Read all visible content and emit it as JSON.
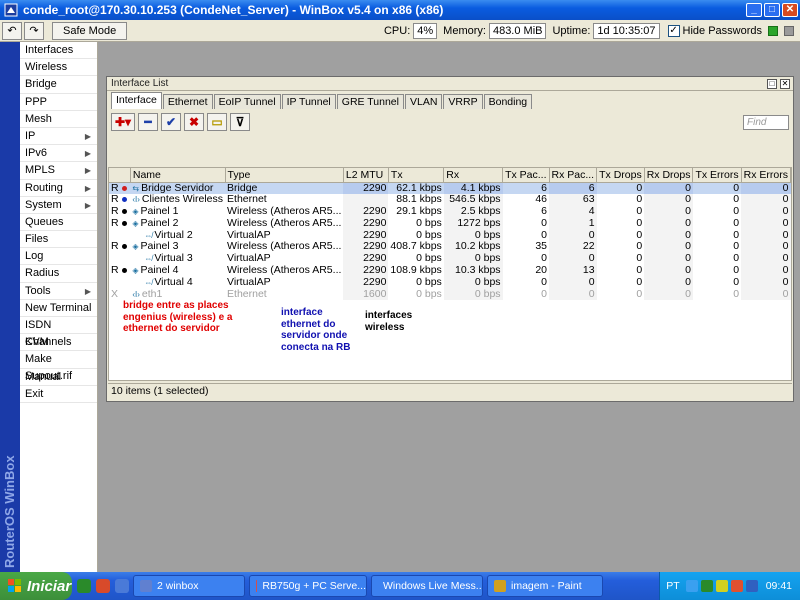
{
  "window": {
    "title": "conde_root@170.30.10.253 (CondeNet_Server) - WinBox v5.4 on x86 (x86)",
    "minimize": "_",
    "maximize": "□",
    "close": "✕"
  },
  "toolbar": {
    "undo": "↶",
    "redo": "↷",
    "safe_mode": "Safe Mode",
    "cpu_label": "CPU:",
    "cpu_value": "4%",
    "memory_label": "Memory:",
    "memory_value": "483.0 MiB",
    "uptime_label": "Uptime:",
    "uptime_value": "1d 10:35:07",
    "hide_passwords_label": "Hide Passwords",
    "hide_passwords_check": "✓"
  },
  "brand": "RouterOS WinBox",
  "sidebar": {
    "items": [
      {
        "label": "Interfaces",
        "arrow": ""
      },
      {
        "label": "Wireless",
        "arrow": ""
      },
      {
        "label": "Bridge",
        "arrow": ""
      },
      {
        "label": "PPP",
        "arrow": ""
      },
      {
        "label": "Mesh",
        "arrow": ""
      },
      {
        "label": "IP",
        "arrow": "▶"
      },
      {
        "label": "IPv6",
        "arrow": "▶"
      },
      {
        "label": "MPLS",
        "arrow": "▶"
      },
      {
        "label": "Routing",
        "arrow": "▶"
      },
      {
        "label": "System",
        "arrow": "▶"
      },
      {
        "label": "Queues",
        "arrow": ""
      },
      {
        "label": "Files",
        "arrow": ""
      },
      {
        "label": "Log",
        "arrow": ""
      },
      {
        "label": "Radius",
        "arrow": ""
      },
      {
        "label": "Tools",
        "arrow": "▶"
      },
      {
        "label": "New Terminal",
        "arrow": ""
      },
      {
        "label": "ISDN Channels",
        "arrow": ""
      },
      {
        "label": "KVM",
        "arrow": ""
      },
      {
        "label": "Make Supout.rif",
        "arrow": ""
      },
      {
        "label": "Manual",
        "arrow": ""
      },
      {
        "label": "Exit",
        "arrow": ""
      }
    ]
  },
  "iface_window": {
    "title": "Interface List",
    "restore": "□",
    "close": "✕",
    "tabs": [
      "Interface",
      "Ethernet",
      "EoIP Tunnel",
      "IP Tunnel",
      "GRE Tunnel",
      "VLAN",
      "VRRP",
      "Bonding"
    ],
    "actions": {
      "add": "✚▾",
      "remove": "━",
      "enable": "✔",
      "disable": "✖",
      "comment": "▭",
      "filter": "⊽"
    },
    "find_placeholder": "Find",
    "columns": [
      "",
      "Name",
      "Type",
      "L2 MTU",
      "Tx",
      "Rx",
      "Tx Pac...",
      "Rx Pac...",
      "Tx Drops",
      "Rx Drops",
      "Tx Errors",
      "Rx Errors"
    ],
    "rows": [
      {
        "flag": "R",
        "dot": "#d02020",
        "icon": "⇆",
        "name": "Bridge Servidor",
        "indent": false,
        "type": "Bridge",
        "l2mtu": "2290",
        "tx": "62.1 kbps",
        "rx": "4.1 kbps",
        "txp": "6",
        "rxp": "6",
        "txd": "0",
        "rxd": "0",
        "txe": "0",
        "rxe": "0",
        "selected": true,
        "disabled": false
      },
      {
        "flag": "R",
        "dot": "#1030c0",
        "icon": "‹I›",
        "name": "Clientes Wireless",
        "indent": false,
        "type": "Ethernet",
        "l2mtu": "",
        "tx": "88.1 kbps",
        "rx": "546.5 kbps",
        "txp": "46",
        "rxp": "63",
        "txd": "0",
        "rxd": "0",
        "txe": "0",
        "rxe": "0",
        "selected": false,
        "disabled": false
      },
      {
        "flag": "R",
        "dot": "#000000",
        "icon": "◈",
        "name": "Painel 1",
        "indent": false,
        "type": "Wireless (Atheros AR5...",
        "l2mtu": "2290",
        "tx": "29.1 kbps",
        "rx": "2.5 kbps",
        "txp": "6",
        "rxp": "4",
        "txd": "0",
        "rxd": "0",
        "txe": "0",
        "rxe": "0",
        "selected": false,
        "disabled": false
      },
      {
        "flag": "R",
        "dot": "#000000",
        "icon": "◈",
        "name": "Painel 2",
        "indent": false,
        "type": "Wireless (Atheros AR5...",
        "l2mtu": "2290",
        "tx": "0 bps",
        "rx": "1272 bps",
        "txp": "0",
        "rxp": "1",
        "txd": "0",
        "rxd": "0",
        "txe": "0",
        "rxe": "0",
        "selected": false,
        "disabled": false
      },
      {
        "flag": "",
        "dot": "",
        "icon": "⇎",
        "name": "Virtual 2",
        "indent": true,
        "type": "VirtualAP",
        "l2mtu": "2290",
        "tx": "0 bps",
        "rx": "0 bps",
        "txp": "0",
        "rxp": "0",
        "txd": "0",
        "rxd": "0",
        "txe": "0",
        "rxe": "0",
        "selected": false,
        "disabled": false
      },
      {
        "flag": "R",
        "dot": "#000000",
        "icon": "◈",
        "name": "Painel 3",
        "indent": false,
        "type": "Wireless (Atheros AR5...",
        "l2mtu": "2290",
        "tx": "408.7 kbps",
        "rx": "10.2 kbps",
        "txp": "35",
        "rxp": "22",
        "txd": "0",
        "rxd": "0",
        "txe": "0",
        "rxe": "0",
        "selected": false,
        "disabled": false
      },
      {
        "flag": "",
        "dot": "",
        "icon": "⇎",
        "name": "Virtual 3",
        "indent": true,
        "type": "VirtualAP",
        "l2mtu": "2290",
        "tx": "0 bps",
        "rx": "0 bps",
        "txp": "0",
        "rxp": "0",
        "txd": "0",
        "rxd": "0",
        "txe": "0",
        "rxe": "0",
        "selected": false,
        "disabled": false
      },
      {
        "flag": "R",
        "dot": "#000000",
        "icon": "◈",
        "name": "Painel 4",
        "indent": false,
        "type": "Wireless (Atheros AR5...",
        "l2mtu": "2290",
        "tx": "108.9 kbps",
        "rx": "10.3 kbps",
        "txp": "20",
        "rxp": "13",
        "txd": "0",
        "rxd": "0",
        "txe": "0",
        "rxe": "0",
        "selected": false,
        "disabled": false
      },
      {
        "flag": "",
        "dot": "",
        "icon": "⇎",
        "name": "Virtual 4",
        "indent": true,
        "type": "VirtualAP",
        "l2mtu": "2290",
        "tx": "0 bps",
        "rx": "0 bps",
        "txp": "0",
        "rxp": "0",
        "txd": "0",
        "rxd": "0",
        "txe": "0",
        "rxe": "0",
        "selected": false,
        "disabled": false
      },
      {
        "flag": "X",
        "dot": "",
        "icon": "‹I›",
        "name": "eth1",
        "indent": false,
        "type": "Ethernet",
        "l2mtu": "1600",
        "tx": "0 bps",
        "rx": "0 bps",
        "txp": "0",
        "rxp": "0",
        "txd": "0",
        "rxd": "0",
        "txe": "0",
        "rxe": "0",
        "selected": false,
        "disabled": true
      }
    ],
    "status": "10 items (1 selected)"
  },
  "annotations": {
    "red": "bridge entre as places engenius (wireless) e a ethernet do servidor",
    "red_color": "#e00000",
    "blue": "interface ethernet do servidor onde conecta na RB",
    "blue_color": "#1010b0",
    "black": "interfaces wireless",
    "black_color": "#000000"
  },
  "taskbar": {
    "start": "Iniciar",
    "tasks": [
      "2 winbox",
      "RB750g + PC Serve...",
      "Windows Live Mess...",
      "imagem - Paint"
    ],
    "lang": "PT",
    "clock": "09:41"
  }
}
